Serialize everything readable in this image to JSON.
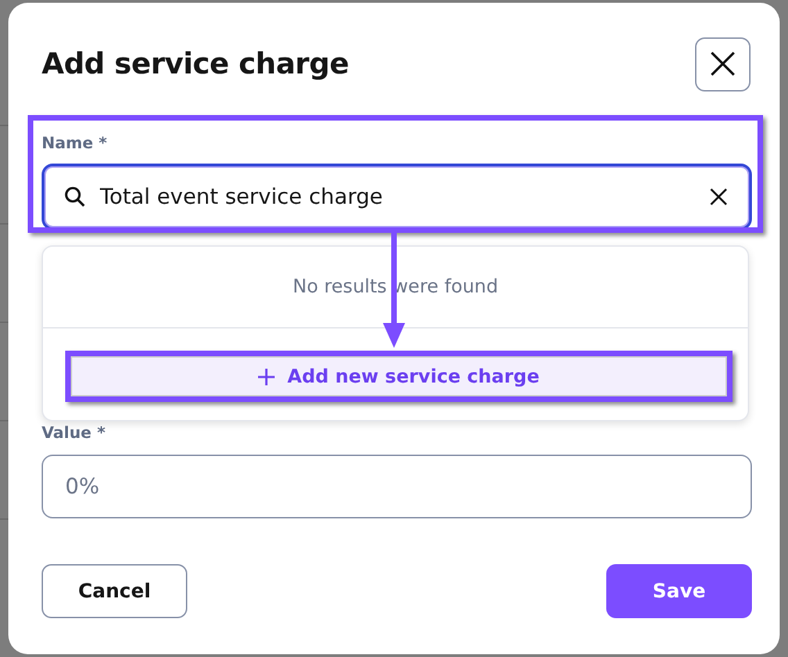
{
  "dialog": {
    "title": "Add service charge"
  },
  "name_field": {
    "label": "Name *",
    "value": "Total event service charge",
    "focused": true
  },
  "dropdown": {
    "empty_message": "No results were found",
    "add_option": {
      "label": "Add new service charge"
    }
  },
  "value_field": {
    "label": "Value *",
    "placeholder": "0%"
  },
  "buttons": [
    {
      "label": "Cancel",
      "kind": "secondary"
    },
    {
      "label": "Save",
      "kind": "primary"
    }
  ]
}
